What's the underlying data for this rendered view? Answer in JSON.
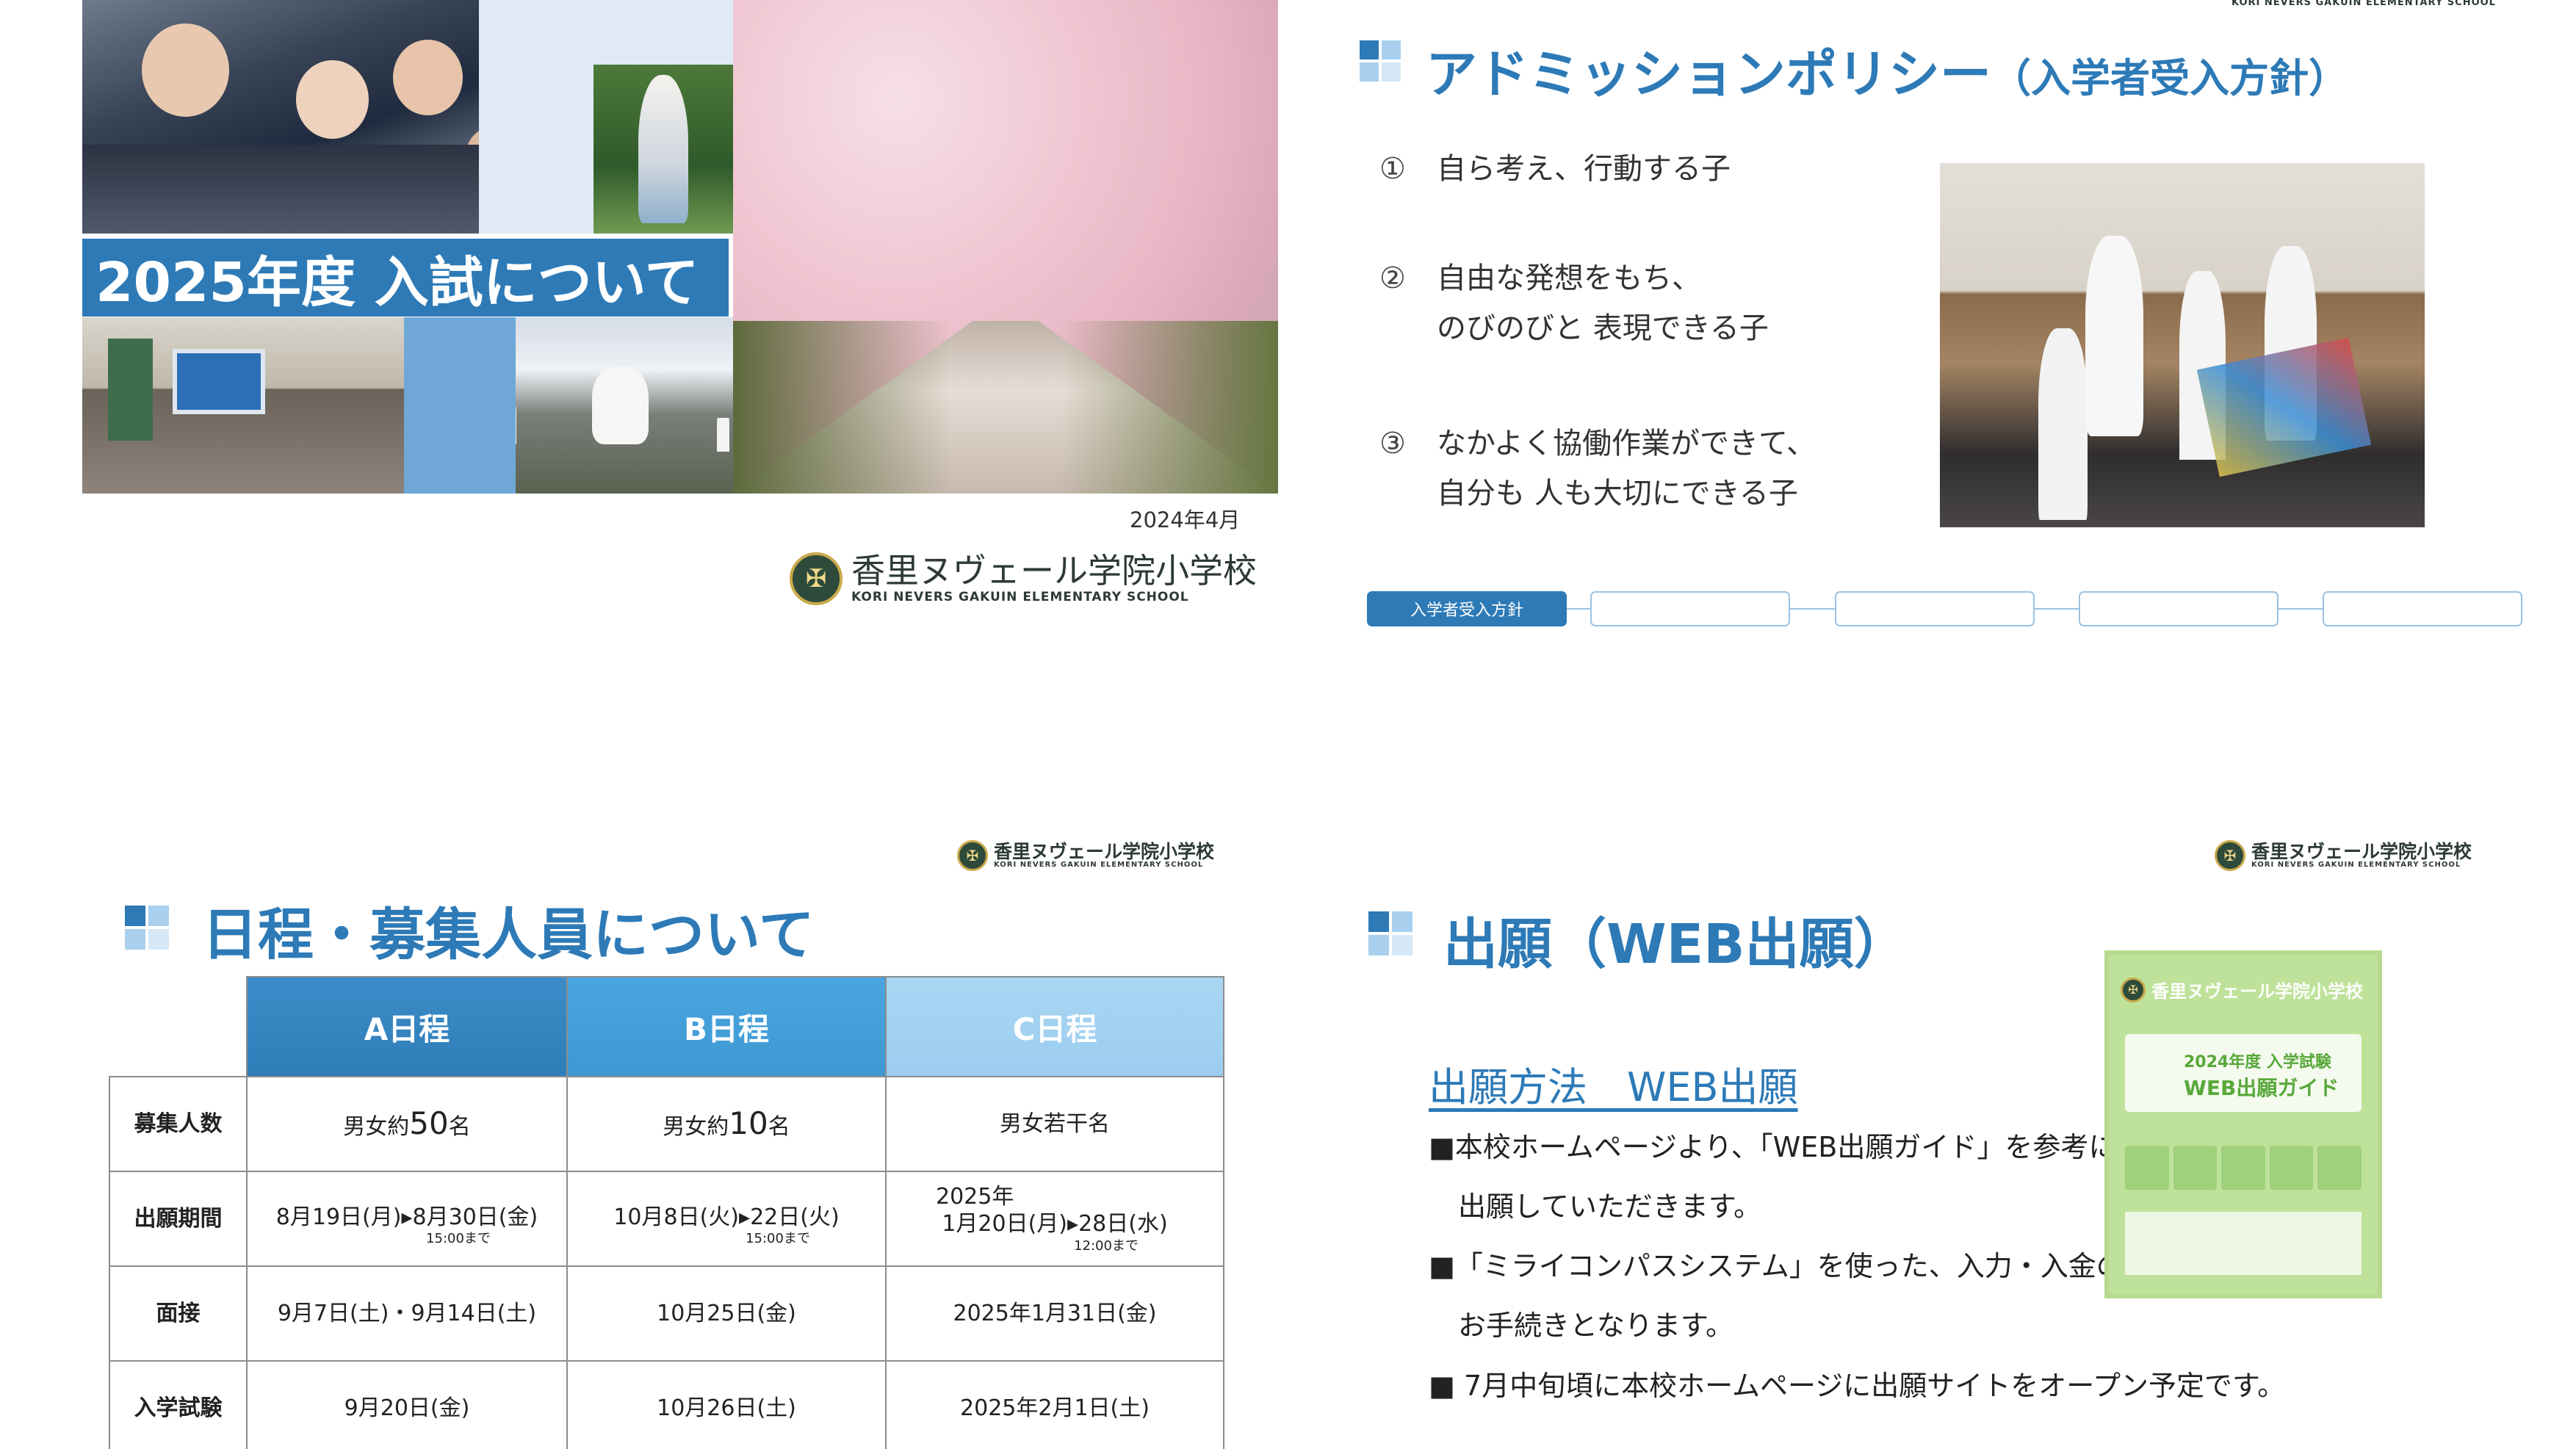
{
  "slide1": {
    "title": "2025年度 入試について",
    "date": "2024年4月",
    "school_ja": "香里ヌヴェール学院小学校",
    "school_en": "KORI NEVERS GAKUIN ELEMENTARY SCHOOL"
  },
  "slide2": {
    "title": "アドミッションポリシー",
    "title_sub": "（入学者受入方針）",
    "header_school_en": "KORI NEVERS GAKUIN ELEMENTARY SCHOOL",
    "policies": [
      {
        "num": "①",
        "line1": "自ら考え、行動する子",
        "line2": ""
      },
      {
        "num": "②",
        "line1": "自由な発想をもち、",
        "line2": "のびのびと 表現できる子"
      },
      {
        "num": "③",
        "line1": "なかよく協働作業ができて、",
        "line2": "自分も 人も大切にできる子"
      }
    ],
    "nav": [
      "入学者受入方針",
      "",
      "",
      "",
      ""
    ]
  },
  "slide3": {
    "school_ja": "香里ヌヴェール学院小学校",
    "school_en": "KORI NEVERS GAKUIN ELEMENTARY SCHOOL",
    "title": "日程・募集人員について",
    "columns": [
      "A日程",
      "B日程",
      "C日程"
    ],
    "rows": {
      "capacity": {
        "label": "募集人数",
        "a_pre": "男女約",
        "a_num": "50",
        "a_post": "名",
        "b_pre": "男女約",
        "b_num": "10",
        "b_post": "名",
        "c": "男女若干名"
      },
      "period": {
        "label": "出願期間",
        "a": "8月19日(月)▸8月30日(金)",
        "a_note": "15:00まで",
        "b": "10月8日(火)▸22日(火)",
        "b_note": "15:00まで",
        "c_year": "2025年",
        "c": "1月20日(月)▸28日(水)",
        "c_note": "12:00まで"
      },
      "interview": {
        "label": "面接",
        "a": "9月7日(土)・9月14日(土)",
        "b": "10月25日(金)",
        "c": "2025年1月31日(金)"
      },
      "exam": {
        "label": "入学試験",
        "a": "9月20日(金)",
        "b": "10月26日(土)",
        "c": "2025年2月1日(土)"
      }
    }
  },
  "slide4": {
    "school_ja": "香里ヌヴェール学院小学校",
    "school_en": "KORI NEVERS GAKUIN ELEMENTARY SCHOOL",
    "title": "出願（WEB出願）",
    "method": "出願方法　WEB出願",
    "bullets": [
      "■本校ホームページより、「WEB出願ガイド」を参考に",
      "出願していただきます。",
      "■「ミライコンパスシステム」を使った、入力・入金の",
      "お手続きとなります。",
      "■ 7月中旬頃に本校ホームページに出願サイトをオープン予定です。"
    ],
    "guide": {
      "school": "香里ヌヴェール学院小学校",
      "line1": "2024年度 入学試験",
      "line2": "WEB出願ガイド"
    }
  },
  "colors": {
    "accent_blue": "#2d7ab7",
    "table_header_a": "#2f7db9",
    "table_header_b": "#3e98d3",
    "table_header_c": "#9ccdf0",
    "guide_green": "#bfe29a"
  }
}
